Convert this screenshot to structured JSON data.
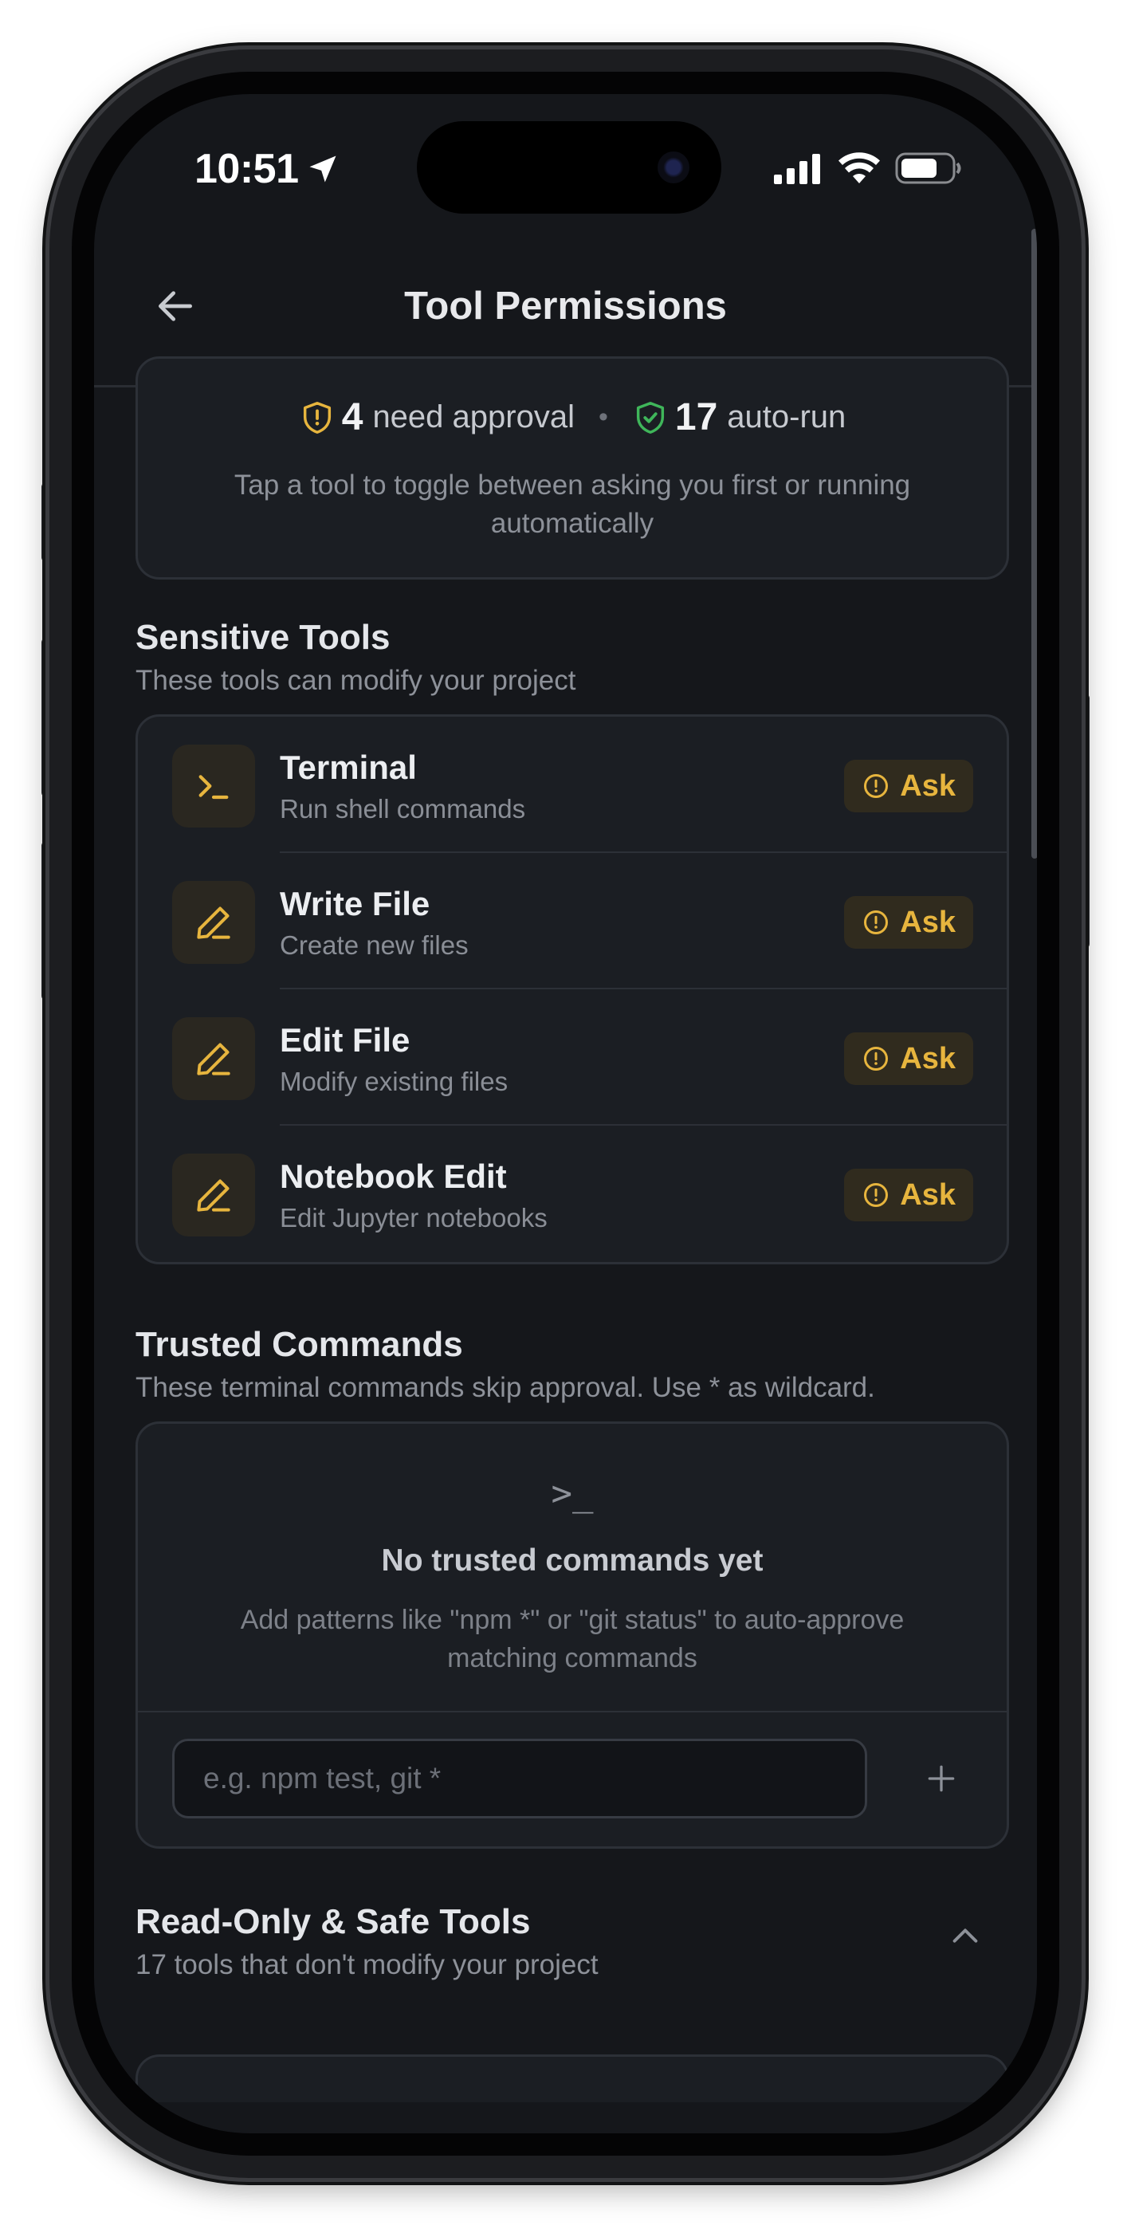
{
  "status_bar": {
    "time": "10:51"
  },
  "header": {
    "title": "Tool Permissions"
  },
  "summary": {
    "approval_count": "4",
    "approval_label": "need approval",
    "separator": "•",
    "autorun_count": "17",
    "autorun_label": "auto-run",
    "description": "Tap a tool to toggle between asking you first or running automatically"
  },
  "sensitive": {
    "title": "Sensitive Tools",
    "subtitle": "These tools can modify your project",
    "tools": [
      {
        "name": "Terminal",
        "description": "Run shell commands",
        "icon": "terminal-icon",
        "badge": "Ask"
      },
      {
        "name": "Write File",
        "description": "Create new files",
        "icon": "pencil-icon",
        "badge": "Ask"
      },
      {
        "name": "Edit File",
        "description": "Modify existing files",
        "icon": "pencil-icon",
        "badge": "Ask"
      },
      {
        "name": "Notebook Edit",
        "description": "Edit Jupyter notebooks",
        "icon": "pencil-icon",
        "badge": "Ask"
      }
    ]
  },
  "trusted": {
    "title": "Trusted Commands",
    "subtitle": "These terminal commands skip approval. Use * as wildcard.",
    "empty_icon": ">_",
    "empty_title": "No trusted commands yet",
    "empty_description": "Add patterns like \"npm *\" or \"git status\" to auto-approve matching commands",
    "input_placeholder": "e.g. npm test, git *",
    "input_value": ""
  },
  "readonly": {
    "title": "Read-Only & Safe Tools",
    "subtitle": "17 tools that don't modify your project"
  },
  "colors": {
    "background": "#15171b",
    "card": "#1b1e23",
    "ask_accent": "#e7b53e",
    "safe_accent": "#3fb65a"
  }
}
